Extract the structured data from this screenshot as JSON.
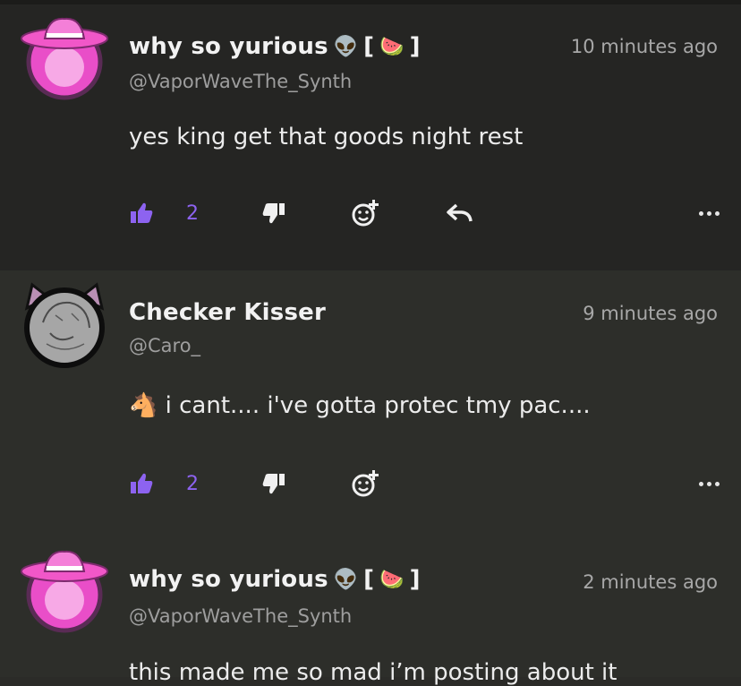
{
  "posts": [
    {
      "name": "why so yurious",
      "handle": "@VaporWaveThe_Synth",
      "time": "10 minutes ago",
      "text": "yes king get that goods night rest",
      "likes": "2",
      "emoji_icons": [
        "alien-face",
        "watermelon"
      ]
    },
    {
      "name": "Checker Kisser",
      "handle": "@Caro_",
      "time": "9 minutes ago",
      "text": "i cant.... i've gotta protec tmy pac....",
      "likes": "2",
      "leading_emoji": "horse"
    },
    {
      "name": "why so yurious",
      "handle": "@VaporWaveThe_Synth",
      "time": "2 minutes ago",
      "text": "this made me so mad i’m posting about it",
      "emoji_icons": [
        "alien-face",
        "watermelon"
      ]
    }
  ],
  "colors": {
    "accent": "#8d63f0",
    "background": "#2b2b28",
    "post_dark": "#252523",
    "text": "#ececec",
    "muted": "#9e9e9e"
  },
  "icons": [
    "thumbs-up-icon",
    "thumbs-down-icon",
    "add-reaction-icon",
    "reply-icon",
    "more-icon"
  ]
}
